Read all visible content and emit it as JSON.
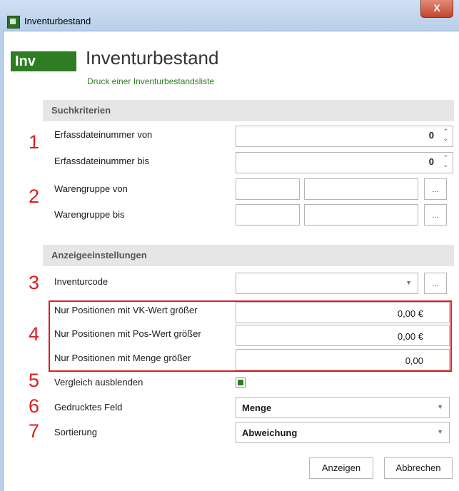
{
  "window": {
    "title": "Inventurbestand",
    "close_label": "X"
  },
  "header": {
    "badge": "Inv",
    "title": "Inventurbestand",
    "subtitle": "Druck einer Inventurbestandsliste"
  },
  "search": {
    "section_title": "Suchkriterien",
    "erfass_von": {
      "label": "Erfassdateinummer von",
      "value": "0"
    },
    "erfass_bis": {
      "label": "Erfassdateinummer bis",
      "value": "0"
    },
    "waren_von": {
      "label": "Warengruppe von",
      "button": "..."
    },
    "waren_bis": {
      "label": "Warengruppe bis",
      "button": "..."
    }
  },
  "display": {
    "section_title": "Anzeigeeinstellungen",
    "inventurcode": {
      "label": "Inventurcode",
      "value": "",
      "button": "..."
    },
    "vk_wert": {
      "label": "Nur Positionen mit VK-Wert größer",
      "value": "0,00 €"
    },
    "pos_wert": {
      "label": "Nur Positionen mit Pos-Wert größer",
      "value": "0,00 €"
    },
    "menge": {
      "label": "Nur Positionen mit Menge größer",
      "value": "0,00"
    },
    "vergleich": {
      "label": "Vergleich ausblenden",
      "checked": true
    },
    "gedruckt": {
      "label": "Gedrucktes Feld",
      "value": "Menge"
    },
    "sortierung": {
      "label": "Sortierung",
      "value": "Abweichung"
    }
  },
  "annotations": [
    "1",
    "2",
    "3",
    "4",
    "5",
    "6",
    "7"
  ],
  "buttons": {
    "show": "Anzeigen",
    "cancel": "Abbrechen"
  },
  "colors": {
    "accent": "#2e7d22",
    "annotation": "#e01c1c"
  },
  "icons": {
    "spin": "spin-arrows-icon",
    "dropdown": "chevron-down-icon"
  }
}
